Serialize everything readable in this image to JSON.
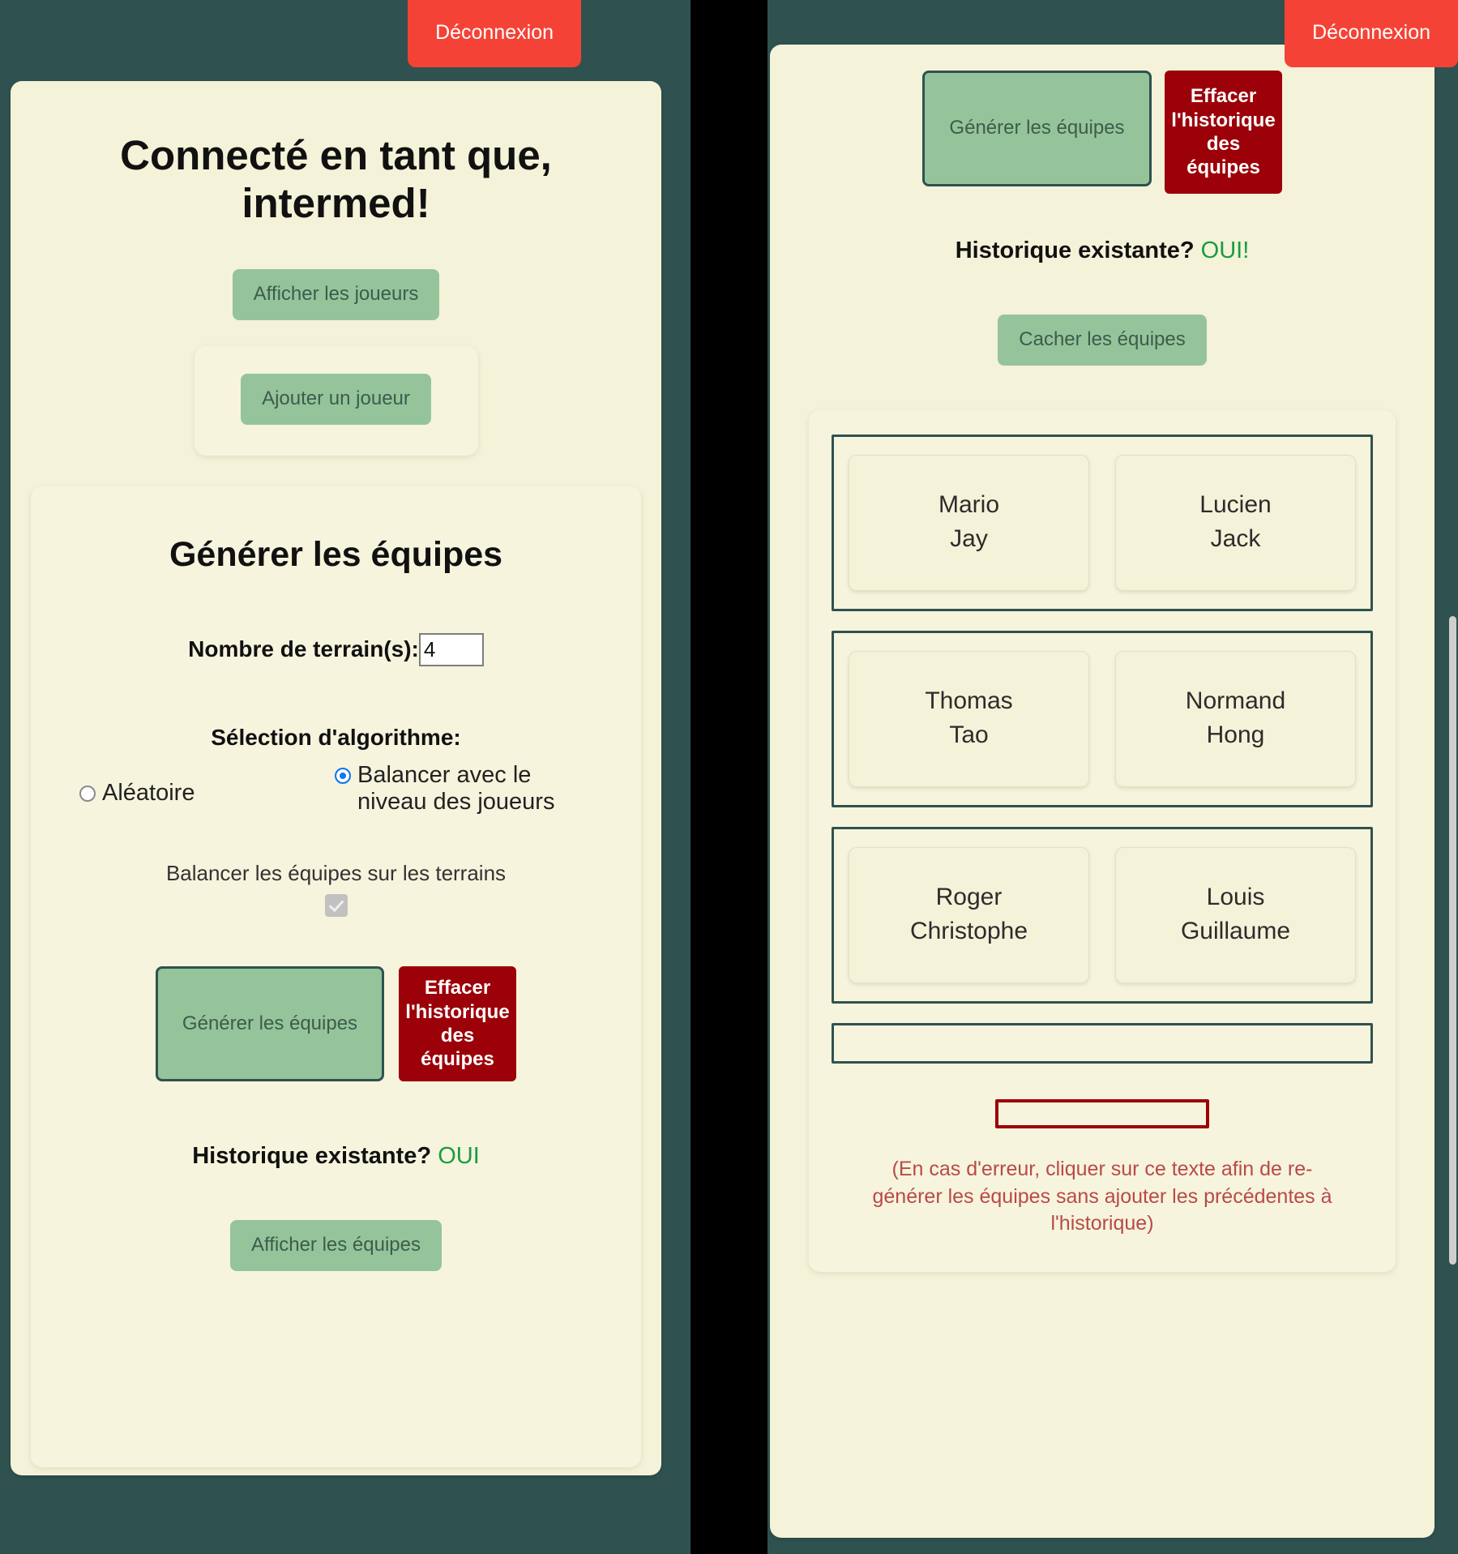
{
  "colors": {
    "app_background": "#2f5250",
    "card_background": "#f4f2d8",
    "accent_green": "#95c49a",
    "accent_darkgreen": "#2f5250",
    "danger_red": "#f44336",
    "erase_red": "#9c0008",
    "success_green": "#189c41",
    "error_text": "#b94a48",
    "radio_blue": "#1076f1"
  },
  "left_panel": {
    "logout_label": "Déconnexion",
    "heading": "Connecté en tant que, intermed!",
    "show_players_label": "Afficher les joueurs",
    "add_player_label": "Ajouter un joueur",
    "generate_section": {
      "title": "Générer les équipes",
      "courts_label": "Nombre de terrain(s):",
      "courts_value": "4",
      "courts_placeholder": "",
      "algorithm_title": "Sélection d'algorithme:",
      "algorithm_options": [
        {
          "label": "Aléatoire",
          "selected": false
        },
        {
          "label": "Balancer avec le niveau des joueurs",
          "selected": true
        }
      ],
      "balance_courts_label": "Balancer les équipes sur les terrains",
      "balance_courts_checked": true,
      "generate_label": "Générer les équipes",
      "erase_history_label": "Effacer l'historique des équipes",
      "history_question": "Historique existante?",
      "history_answer": "OUI",
      "show_teams_label": "Afficher les équipes"
    }
  },
  "right_panel": {
    "logout_label": "Déconnexion",
    "generate_label": "Générer les équipes",
    "erase_history_label": "Effacer l'historique des équipes",
    "history_question": "Historique existante?",
    "history_answer": "OUI!",
    "hide_teams_label": "Cacher les équipes",
    "courts": [
      {
        "teams": [
          {
            "players": [
              "Mario",
              "Jay"
            ]
          },
          {
            "players": [
              "Lucien",
              "Jack"
            ]
          }
        ]
      },
      {
        "teams": [
          {
            "players": [
              "Thomas",
              "Tao"
            ]
          },
          {
            "players": [
              "Normand",
              "Hong"
            ]
          }
        ]
      },
      {
        "teams": [
          {
            "players": [
              "Roger",
              "Christophe"
            ]
          },
          {
            "players": [
              "Louis",
              "Guillaume"
            ]
          }
        ]
      },
      {
        "teams": []
      }
    ],
    "regenerate_note": "(En cas d'erreur, cliquer sur ce texte afin de re-générer les équipes sans ajouter les précédentes à l'historique)"
  }
}
